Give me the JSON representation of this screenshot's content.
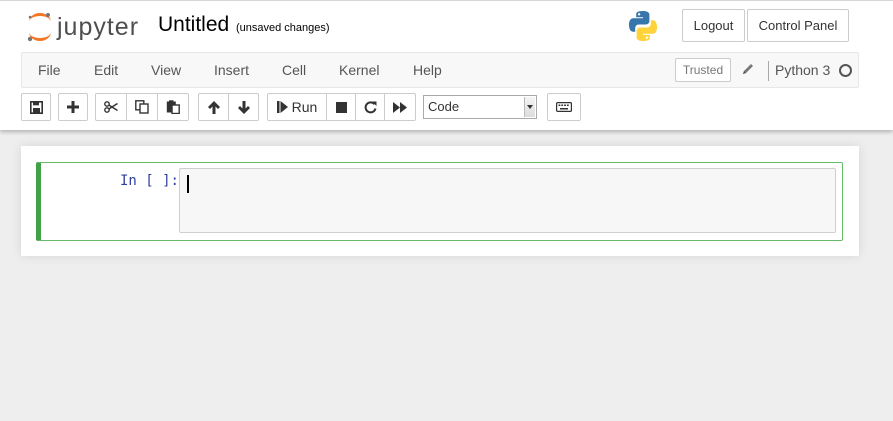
{
  "header": {
    "logo_text": "jupyter",
    "notebook_name": "Untitled",
    "save_status": "(unsaved changes)",
    "logout_label": "Logout",
    "control_panel_label": "Control Panel"
  },
  "menubar": {
    "items": [
      "File",
      "Edit",
      "View",
      "Insert",
      "Cell",
      "Kernel",
      "Help"
    ],
    "trusted_label": "Trusted",
    "kernel_name": "Python 3"
  },
  "toolbar": {
    "run_label": "Run",
    "cell_type": "Code"
  },
  "cell": {
    "prompt": "In [ ]:",
    "code": ""
  },
  "colors": {
    "jupyter_orange": "#f37726",
    "cell_selected_border": "#42a046",
    "prompt_color": "#303f9f"
  }
}
